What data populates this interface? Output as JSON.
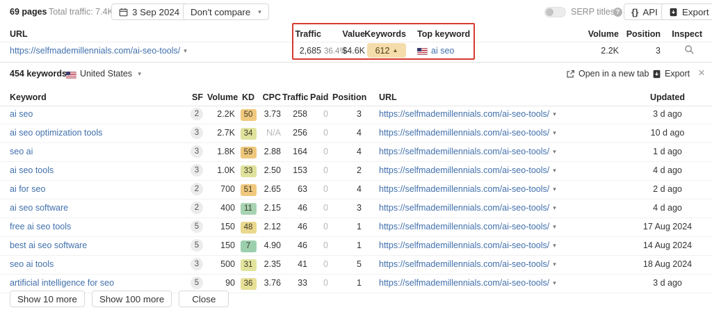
{
  "topbar": {
    "pages": "69 pages",
    "total_traffic": "Total traffic: 7.4K",
    "date": "3 Sep 2024",
    "compare": "Don't compare",
    "serp_titles": "SERP titles",
    "api": "API",
    "export": "Export"
  },
  "summary": {
    "headers": {
      "url": "URL",
      "traffic": "Traffic",
      "value": "Value",
      "keywords": "Keywords",
      "top_keyword": "Top keyword",
      "volume": "Volume",
      "position": "Position",
      "inspect": "Inspect"
    },
    "row": {
      "url": "https://selfmademillennials.com/ai-seo-tools/",
      "traffic": "2,685",
      "traffic_pct": "36.4%",
      "value": "$4.6K",
      "keywords": "612",
      "top_keyword": "ai seo",
      "volume": "2.2K",
      "position": "3"
    }
  },
  "panel": {
    "count": "454 keywords",
    "country": "United States",
    "open_new_tab": "Open in a new tab",
    "export": "Export"
  },
  "table": {
    "headers": {
      "keyword": "Keyword",
      "sf": "SF",
      "volume": "Volume",
      "kd": "KD",
      "cpc": "CPC",
      "traffic": "Traffic",
      "paid": "Paid",
      "position": "Position",
      "url": "URL",
      "updated": "Updated"
    },
    "rows": [
      {
        "keyword": "ai seo",
        "sf": "2",
        "volume": "2.2K",
        "kd": "50",
        "kd_color": "#f0c97e",
        "cpc": "3.73",
        "traffic": "258",
        "paid": "0",
        "position": "3",
        "url": "https://selfmademillennials.com/ai-seo-tools/",
        "updated": "3 d ago"
      },
      {
        "keyword": "ai seo optimization tools",
        "sf": "3",
        "volume": "2.7K",
        "kd": "34",
        "kd_color": "#dfe29c",
        "cpc": "N/A",
        "traffic": "256",
        "paid": "0",
        "position": "4",
        "url": "https://selfmademillennials.com/ai-seo-tools/",
        "updated": "10 d ago"
      },
      {
        "keyword": "seo ai",
        "sf": "3",
        "volume": "1.8K",
        "kd": "59",
        "kd_color": "#eec77b",
        "cpc": "2.88",
        "traffic": "164",
        "paid": "0",
        "position": "4",
        "url": "https://selfmademillennials.com/ai-seo-tools/",
        "updated": "1 d ago"
      },
      {
        "keyword": "ai seo tools",
        "sf": "3",
        "volume": "1.0K",
        "kd": "33",
        "kd_color": "#dfe29c",
        "cpc": "2.50",
        "traffic": "153",
        "paid": "0",
        "position": "2",
        "url": "https://selfmademillennials.com/ai-seo-tools/",
        "updated": "4 d ago"
      },
      {
        "keyword": "ai for seo",
        "sf": "2",
        "volume": "700",
        "kd": "51",
        "kd_color": "#f0c97e",
        "cpc": "2.65",
        "traffic": "63",
        "paid": "0",
        "position": "4",
        "url": "https://selfmademillennials.com/ai-seo-tools/",
        "updated": "2 d ago"
      },
      {
        "keyword": "ai seo software",
        "sf": "2",
        "volume": "400",
        "kd": "11",
        "kd_color": "#a7d3b3",
        "cpc": "2.15",
        "traffic": "46",
        "paid": "0",
        "position": "3",
        "url": "https://selfmademillennials.com/ai-seo-tools/",
        "updated": "4 d ago"
      },
      {
        "keyword": "free ai seo tools",
        "sf": "5",
        "volume": "150",
        "kd": "48",
        "kd_color": "#ead88d",
        "cpc": "2.12",
        "traffic": "46",
        "paid": "0",
        "position": "1",
        "url": "https://selfmademillennials.com/ai-seo-tools/",
        "updated": "17 Aug 2024"
      },
      {
        "keyword": "best ai seo software",
        "sf": "5",
        "volume": "150",
        "kd": "7",
        "kd_color": "#9ccfad",
        "cpc": "4.90",
        "traffic": "46",
        "paid": "0",
        "position": "1",
        "url": "https://selfmademillennials.com/ai-seo-tools/",
        "updated": "14 Aug 2024"
      },
      {
        "keyword": "seo ai tools",
        "sf": "3",
        "volume": "500",
        "kd": "31",
        "kd_color": "#e2e49d",
        "cpc": "2.35",
        "traffic": "41",
        "paid": "0",
        "position": "5",
        "url": "https://selfmademillennials.com/ai-seo-tools/",
        "updated": "18 Aug 2024"
      },
      {
        "keyword": "artificial intelligence for seo",
        "sf": "5",
        "volume": "90",
        "kd": "36",
        "kd_color": "#e6df96",
        "cpc": "3.76",
        "traffic": "33",
        "paid": "0",
        "position": "1",
        "url": "https://selfmademillennials.com/ai-seo-tools/",
        "updated": "3 d ago"
      }
    ]
  },
  "footer": {
    "show_10_more": "Show 10 more",
    "show_100_more": "Show 100 more",
    "close": "Close"
  },
  "icons": {
    "caret_down": "▾",
    "sort_up": "▲",
    "close": "×",
    "braces": "{}",
    "help": "?"
  },
  "colors": {
    "link_blue": "#4170ac",
    "highlight_red": "#d63a2f",
    "keywords_badge_bg": "#f5dcab",
    "kd_amber": "#f0c97e",
    "kd_yellow": "#dfe29c",
    "kd_green": "#a7d3b3"
  }
}
